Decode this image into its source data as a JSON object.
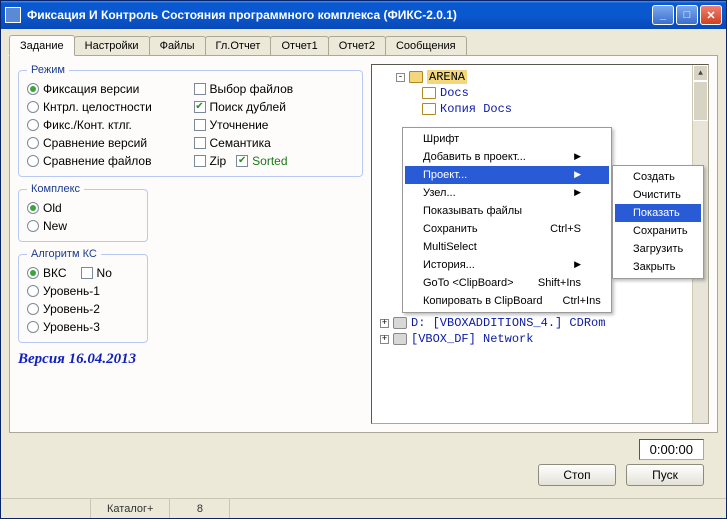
{
  "window": {
    "title": "Фиксация И Контроль Состояния программного комплекса (ФИКС-2.0.1)"
  },
  "tabs": [
    {
      "label": "Задание",
      "active": true
    },
    {
      "label": "Настройки"
    },
    {
      "label": "Файлы"
    },
    {
      "label": "Гл.Отчет"
    },
    {
      "label": "Отчет1"
    },
    {
      "label": "Отчет2"
    },
    {
      "label": "Сообщения"
    }
  ],
  "groups": {
    "mode_title": "Режим",
    "komplex_title": "Комплекс",
    "algo_title": "Алгоритм КС"
  },
  "mode_radios": [
    {
      "label": "Фиксация версии",
      "selected": true
    },
    {
      "label": "Кнтрл. целостности"
    },
    {
      "label": "Фикс./Конт. ктлг."
    },
    {
      "label": "Сравнение версий"
    },
    {
      "label": "Сравнение файлов"
    }
  ],
  "mode_checks": [
    {
      "label": "Выбор файлов",
      "checked": false
    },
    {
      "label": "Поиск дублей",
      "checked": true
    },
    {
      "label": "Уточнение",
      "checked": false
    },
    {
      "label": "Семантика",
      "checked": false
    }
  ],
  "mode_zip": {
    "label": "Zip",
    "checked": false
  },
  "mode_sorted": {
    "label": "Sorted",
    "checked": true
  },
  "komplex": [
    {
      "label": "Old",
      "selected": true
    },
    {
      "label": "New"
    }
  ],
  "algo_main": {
    "label": "ВКС",
    "selected": true
  },
  "algo_no": {
    "label": "No",
    "checked": false
  },
  "algo_levels": [
    {
      "label": "Уровень-1"
    },
    {
      "label": "Уровень-2"
    },
    {
      "label": "Уровень-3"
    }
  ],
  "version_label": "Версия 16.04.2013",
  "tree": [
    {
      "indent": 1,
      "pm": "-",
      "icon": "folder",
      "label": "ARENA",
      "sel": true
    },
    {
      "indent": 2,
      "pm": "",
      "icon": "page",
      "label": "Docs"
    },
    {
      "indent": 2,
      "pm": "",
      "icon": "page",
      "label": "Копия Docs"
    }
  ],
  "tree_bottom": [
    {
      "indent": 0,
      "pm": "+",
      "icon": "drive",
      "label": "D: [VBOXADDITIONS_4.] CDRom"
    },
    {
      "indent": 0,
      "pm": "+",
      "icon": "drive",
      "label": "[VBOX_DF] Network"
    }
  ],
  "context_menu": {
    "items": [
      {
        "label": "Шрифт"
      },
      {
        "label": "Добавить в проект...",
        "submenu": true
      },
      {
        "label": "Проект...",
        "submenu": true,
        "highlight": true
      },
      {
        "label": "Узел...",
        "submenu": true
      },
      {
        "label": "Показывать файлы"
      },
      {
        "label": "Сохранить",
        "shortcut": "Ctrl+S"
      },
      {
        "label": "MultiSelect"
      },
      {
        "label": "История...",
        "submenu": true
      },
      {
        "label": "GoTo <ClipBoard>",
        "shortcut": "Shift+Ins"
      },
      {
        "label": "Копировать в ClipBoard",
        "shortcut": "Ctrl+Ins"
      }
    ]
  },
  "submenu": {
    "items": [
      {
        "label": "Создать"
      },
      {
        "label": "Очистить"
      },
      {
        "label": "Показать",
        "highlight": true
      },
      {
        "label": "Сохранить"
      },
      {
        "label": "Загрузить"
      },
      {
        "label": "Закрыть"
      }
    ]
  },
  "timer": "0:00:00",
  "buttons": {
    "stop": "Стоп",
    "start": "Пуск"
  },
  "status": {
    "catalog": "Каталог+",
    "count": "8"
  }
}
